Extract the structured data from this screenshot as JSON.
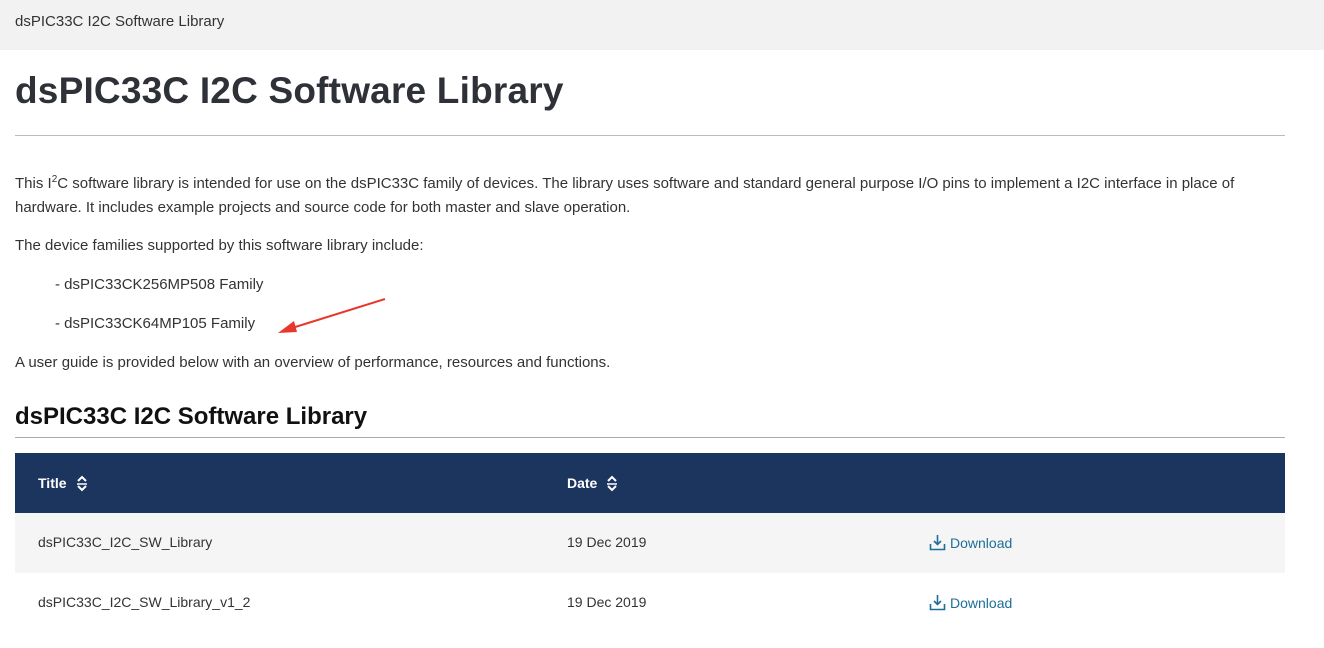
{
  "breadcrumb": {
    "current": "dsPIC33C I2C Software Library"
  },
  "page": {
    "title": "dsPIC33C I2C Software Library",
    "intro_pre": "This I",
    "intro_sup": "2",
    "intro_post": "C software library is intended for use on the dsPIC33C family of devices. The library uses software and standard general purpose I/O pins to implement a I2C interface in place of hardware. It includes example projects and source code for both master and slave operation.",
    "families_lead": "The device families supported by this software library include:",
    "families": [
      "- dsPIC33CK256MP508 Family",
      "- dsPIC33CK64MP105 Family"
    ],
    "user_guide_text": "A user guide is provided below with an overview of performance, resources and functions.",
    "annotation": {
      "color": "#e8382b",
      "icon": "red-arrow-annotation"
    }
  },
  "section": {
    "title": "dsPIC33C I2C Software Library",
    "table": {
      "header_bg": "#1c355e",
      "columns": [
        "Title",
        "Date"
      ],
      "rows": [
        {
          "title": "dsPIC33C_I2C_SW_Library",
          "date": "19 Dec 2019",
          "action": "Download"
        },
        {
          "title": "dsPIC33C_I2C_SW_Library_v1_2",
          "date": "19 Dec 2019",
          "action": "Download"
        }
      ]
    }
  }
}
